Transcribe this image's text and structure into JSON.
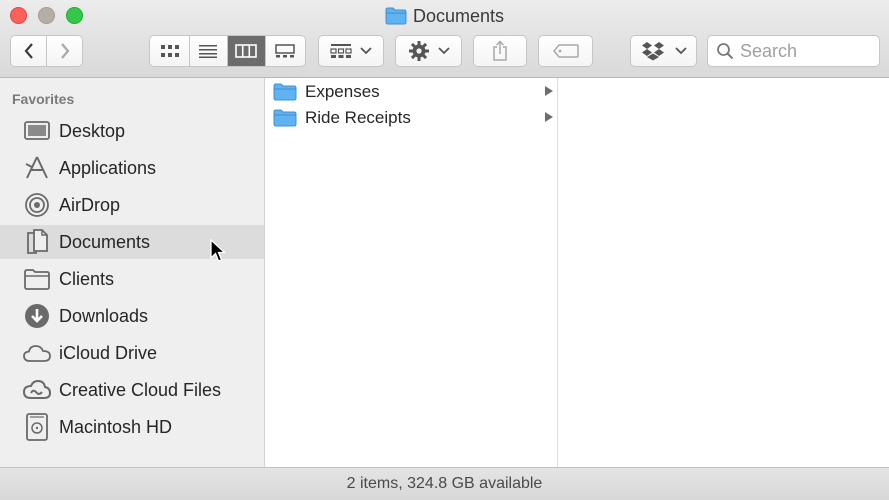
{
  "window": {
    "title": "Documents"
  },
  "toolbar": {
    "search_placeholder": "Search"
  },
  "sidebar": {
    "header": "Favorites",
    "items": [
      {
        "label": "Desktop",
        "icon": "desktop-icon"
      },
      {
        "label": "Applications",
        "icon": "applications-icon"
      },
      {
        "label": "AirDrop",
        "icon": "airdrop-icon"
      },
      {
        "label": "Documents",
        "icon": "documents-icon",
        "selected": true
      },
      {
        "label": "Clients",
        "icon": "folder-icon"
      },
      {
        "label": "Downloads",
        "icon": "downloads-icon"
      },
      {
        "label": "iCloud Drive",
        "icon": "icloud-icon"
      },
      {
        "label": "Creative Cloud Files",
        "icon": "creative-cloud-icon"
      },
      {
        "label": "Macintosh HD",
        "icon": "hard-drive-icon"
      }
    ]
  },
  "column1": {
    "items": [
      {
        "label": "Expenses",
        "icon": "folder-icon"
      },
      {
        "label": "Ride Receipts",
        "icon": "folder-icon"
      }
    ]
  },
  "status": {
    "text": "2 items, 324.8 GB available"
  },
  "colors": {
    "folder_blue": "#5fb3f0",
    "selected_row": "#dcdcdc",
    "active_segment": "#6c6c6c"
  }
}
